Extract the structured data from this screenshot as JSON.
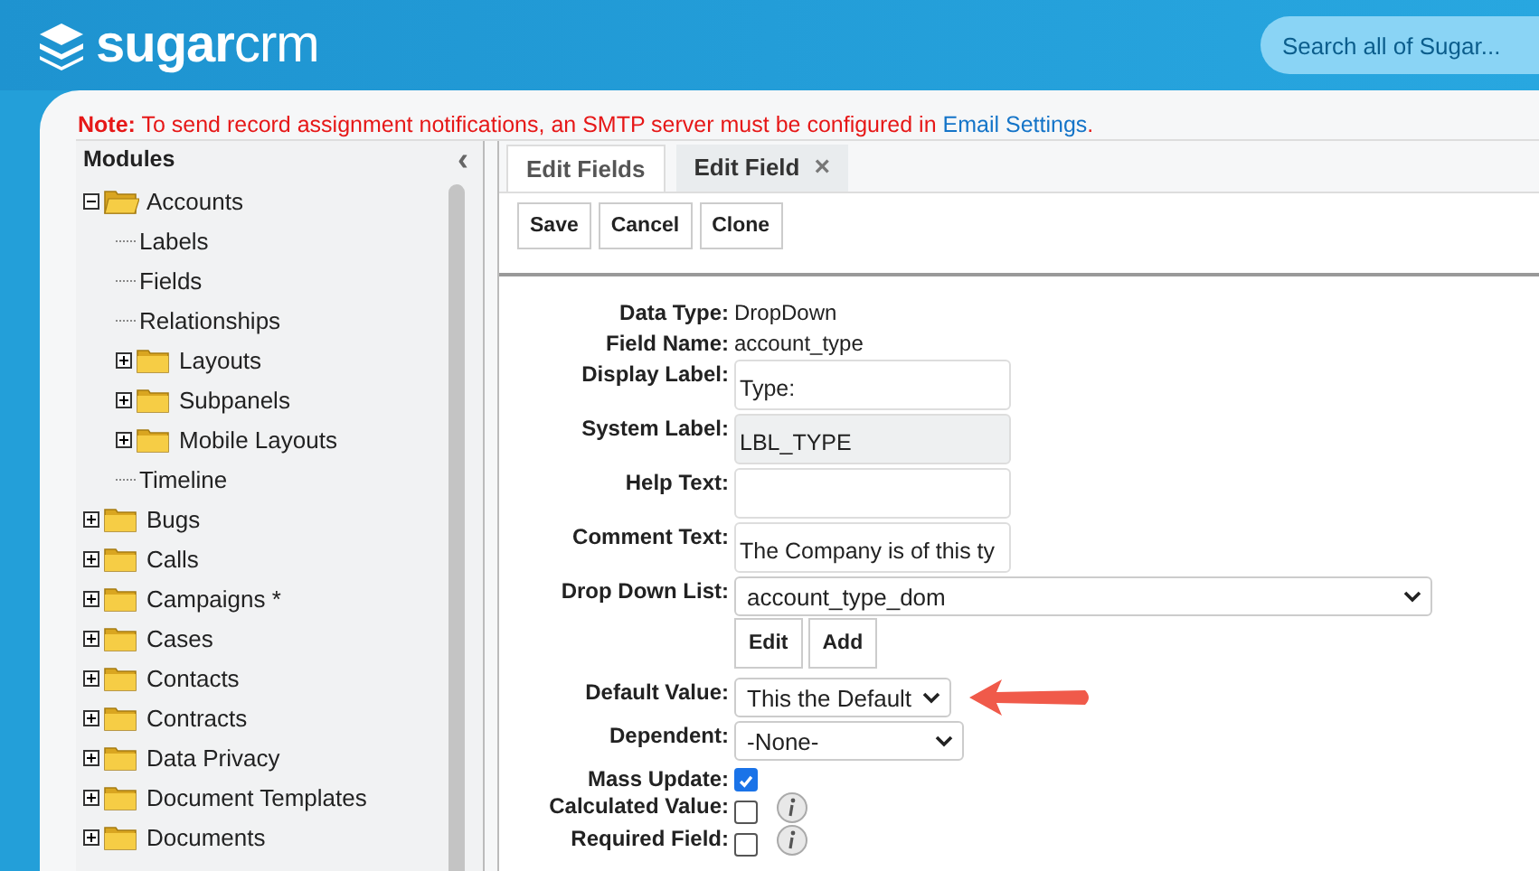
{
  "header": {
    "logo_bold": "sugar",
    "logo_light": "crm",
    "search": {
      "placeholder": "Search all of Sugar..."
    }
  },
  "note": {
    "text": "**Note:** To send record assignment notifications, an SMTP server must be configured in",
    "link": "Email Settings",
    "end": "."
  },
  "sidebar": {
    "title": "Modules",
    "collapse": "‹",
    "items": [
      {
        "name": "Accounts",
        "kind": "folder",
        "expanded": true,
        "children": [
          {
            "name": "Labels",
            "kind": "leaf"
          },
          {
            "name": "Fields",
            "kind": "leaf"
          },
          {
            "name": "Relationships",
            "kind": "leaf"
          },
          {
            "name": "Layouts",
            "kind": "folder",
            "expanded": false
          },
          {
            "name": "Subpanels",
            "kind": "folder",
            "expanded": false
          },
          {
            "name": "Mobile Layouts",
            "kind": "folder",
            "expanded": false
          },
          {
            "name": "Timeline",
            "kind": "leaf"
          }
        ]
      },
      {
        "name": "Bugs",
        "kind": "folder",
        "expanded": false
      },
      {
        "name": "Calls",
        "kind": "folder",
        "expanded": false
      },
      {
        "name": "Campaigns *",
        "kind": "folder",
        "expanded": false
      },
      {
        "name": "Cases",
        "kind": "folder",
        "expanded": false
      },
      {
        "name": "Contacts",
        "kind": "folder",
        "expanded": false
      },
      {
        "name": "Contracts",
        "kind": "folder",
        "expanded": false
      },
      {
        "name": "Data Privacy",
        "kind": "folder",
        "expanded": false
      },
      {
        "name": "Document Templates",
        "kind": "folder",
        "expanded": false
      },
      {
        "name": "Documents",
        "kind": "folder",
        "expanded": false
      }
    ]
  },
  "tabs": [
    {
      "label": "Edit Fields",
      "selected": false,
      "closable": false
    },
    {
      "label": "Edit Field",
      "selected": true,
      "closable": true
    }
  ],
  "close_glyph": "×",
  "toolbar": [
    "Save",
    "Cancel",
    "Clone"
  ],
  "form": [
    {
      "label": "Data Type:",
      "kind": "text",
      "value": "DropDown"
    },
    {
      "label": "Field Name:",
      "kind": "text",
      "value": "account_type"
    },
    {
      "label": "Display Label:",
      "kind": "input",
      "value": "Type:",
      "disabled": false
    },
    {
      "label": "System Label:",
      "kind": "input",
      "value": "LBL_TYPE",
      "disabled": true
    },
    {
      "label": "Help Text:",
      "kind": "input",
      "disabled": false
    },
    {
      "label": "Comment Text:",
      "kind": "input",
      "value": "The Company is of this ty",
      "disabled": false
    },
    {
      "label": "Drop Down List:",
      "kind": "select",
      "value": "account_type_dom",
      "wide": true,
      "buttons": [
        "Edit",
        "Add"
      ]
    },
    {
      "label": "Default Value:",
      "kind": "select",
      "value": "This the Default",
      "wide": false,
      "annotated": true
    },
    {
      "label": "Dependent:",
      "kind": "select",
      "value": "-None-",
      "wide": false
    },
    {
      "label": "Mass Update:",
      "kind": "checkbox",
      "checked": true,
      "info": false
    },
    {
      "label": "Calculated Value:",
      "kind": "checkbox",
      "checked": false,
      "info": true
    },
    {
      "label": "Required Field:",
      "kind": "checkbox",
      "checked": false,
      "info": true
    }
  ]
}
